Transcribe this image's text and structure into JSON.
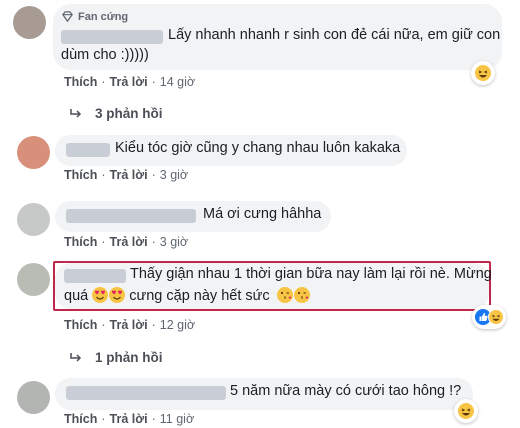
{
  "comments": [
    {
      "badge": "Fan cứng",
      "text_line1": "Lấy nhanh nhanh r sinh con đẻ cái nữa, em giữ con",
      "text_line2": "dùm cho :)))))",
      "like": "Thích",
      "reply": "Trả lời",
      "time": "14 giờ",
      "reaction": "haha",
      "replies_count": "3 phản hồi"
    },
    {
      "text": "Kiểu tóc giờ cũng y chang nhau luôn kakaka",
      "like": "Thích",
      "reply": "Trả lời",
      "time": "3 giờ"
    },
    {
      "text": "Má ơi cưng hâhha",
      "like": "Thích",
      "reply": "Trả lời",
      "time": "3 giờ"
    },
    {
      "text_line1": "Thấy giận nhau 1 thời gian bữa nay làm lại rồi nè. Mừng",
      "text_line2_a": "quá",
      "text_line2_b": "cưng cặp này hết sức",
      "like": "Thích",
      "reply": "Trả lời",
      "time": "12 giờ",
      "reaction": "like",
      "replies_count": "1 phản hồi"
    },
    {
      "text": "5 năm nữa mày có cưới tao hông !?",
      "like": "Thích",
      "reply": "Trả lời",
      "time": "11 giờ",
      "reaction": "haha"
    }
  ],
  "separator": "·",
  "colors": {
    "bubble": "#f2f3f5",
    "link": "#4b4f56",
    "meta": "#606770",
    "highlight_border": "#c2274b",
    "like_blue": "#1877f2",
    "emoji_yellow": "#f7c443"
  }
}
